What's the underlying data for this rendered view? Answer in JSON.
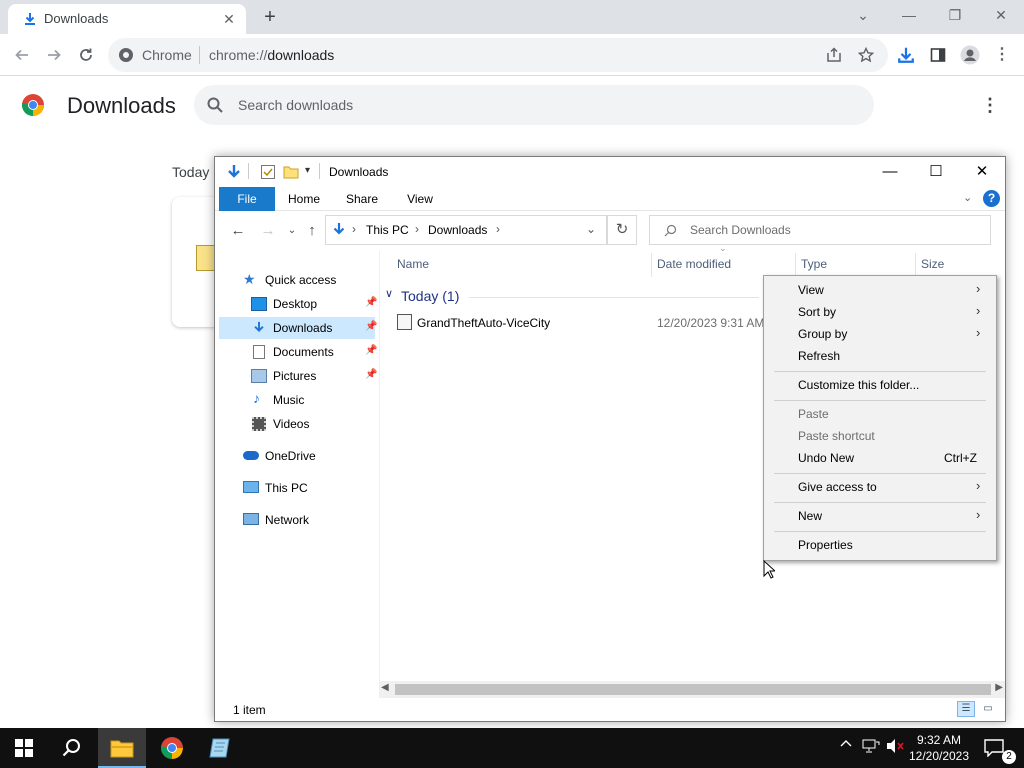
{
  "chrome": {
    "tab_title": "Downloads",
    "tab_close": "✕",
    "new_tab": "+",
    "address_chip": "Chrome",
    "address_url_scheme": "chrome://",
    "address_url_host": "downloads",
    "page_title": "Downloads",
    "search_placeholder": "Search downloads",
    "page_menu": "⋮",
    "today_label": "Today"
  },
  "explorer": {
    "title": "Downloads",
    "ribbon_tabs": [
      "File",
      "Home",
      "Share",
      "View"
    ],
    "help": "?",
    "breadcrumb": [
      "This PC",
      "Downloads"
    ],
    "search_placeholder": "Search Downloads",
    "nav": {
      "quick_access": "Quick access",
      "desktop": "Desktop",
      "downloads": "Downloads",
      "documents": "Documents",
      "pictures": "Pictures",
      "music": "Music",
      "videos": "Videos",
      "onedrive": "OneDrive",
      "this_pc": "This PC",
      "network": "Network"
    },
    "columns": {
      "name": "Name",
      "date_modified": "Date modified",
      "type": "Type",
      "size": "Size"
    },
    "group_header": "Today (1)",
    "files": [
      {
        "name": "GrandTheftAuto-ViceCity",
        "date": "12/20/2023 9:31 AM"
      }
    ],
    "status_count": "1 item"
  },
  "context_menu": {
    "view": "View",
    "sort_by": "Sort by",
    "group_by": "Group by",
    "refresh": "Refresh",
    "customize": "Customize this folder...",
    "paste": "Paste",
    "paste_shortcut": "Paste shortcut",
    "undo_new": "Undo New",
    "undo_shortcut": "Ctrl+Z",
    "give_access": "Give access to",
    "new": "New",
    "properties": "Properties"
  },
  "taskbar": {
    "time": "9:32 AM",
    "date": "12/20/2023",
    "notification_count": "2"
  },
  "colors": {
    "chrome_tabbar": "#dee1e6",
    "ribbon_file": "#1979ca",
    "nav_selected": "#cce8ff",
    "taskbar": "#101010"
  }
}
